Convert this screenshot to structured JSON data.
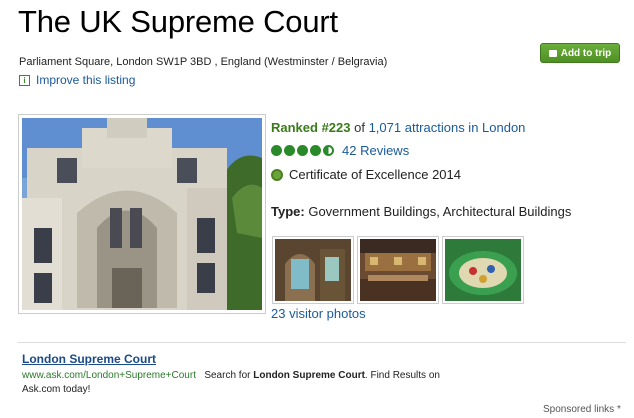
{
  "header": {
    "title": "The UK Supreme Court",
    "address": "Parliament Square, London SW1P 3BD , England (Westminster / Belgravia)",
    "improve_label": "Improve this listing",
    "add_to_trip_label": "Add to trip"
  },
  "listing": {
    "ranked_prefix": "Ranked #223",
    "ranked_of": " of ",
    "ranked_link": "1,071 attractions in London",
    "rating_bubbles": 4.5,
    "reviews_label": "42 Reviews",
    "certificate": "Certificate of Excellence 2014",
    "type_label": "Type:",
    "type_value": " Government Buildings, Architectural Buildings",
    "visitor_photos": "23 visitor photos"
  },
  "ad": {
    "title": "London Supreme Court",
    "url": "www.ask.com/London+Supreme+Court",
    "text_prefix": "Search for ",
    "text_bold": "London Supreme Court",
    "text_suffix": ". Find Results on Ask.com today!",
    "sponsored_label": "Sponsored links ",
    "sponsored_icon": "*"
  },
  "colors": {
    "accent_green": "#3a7a1a",
    "link_blue": "#1a5a9a",
    "button_green": "#5fa032"
  }
}
